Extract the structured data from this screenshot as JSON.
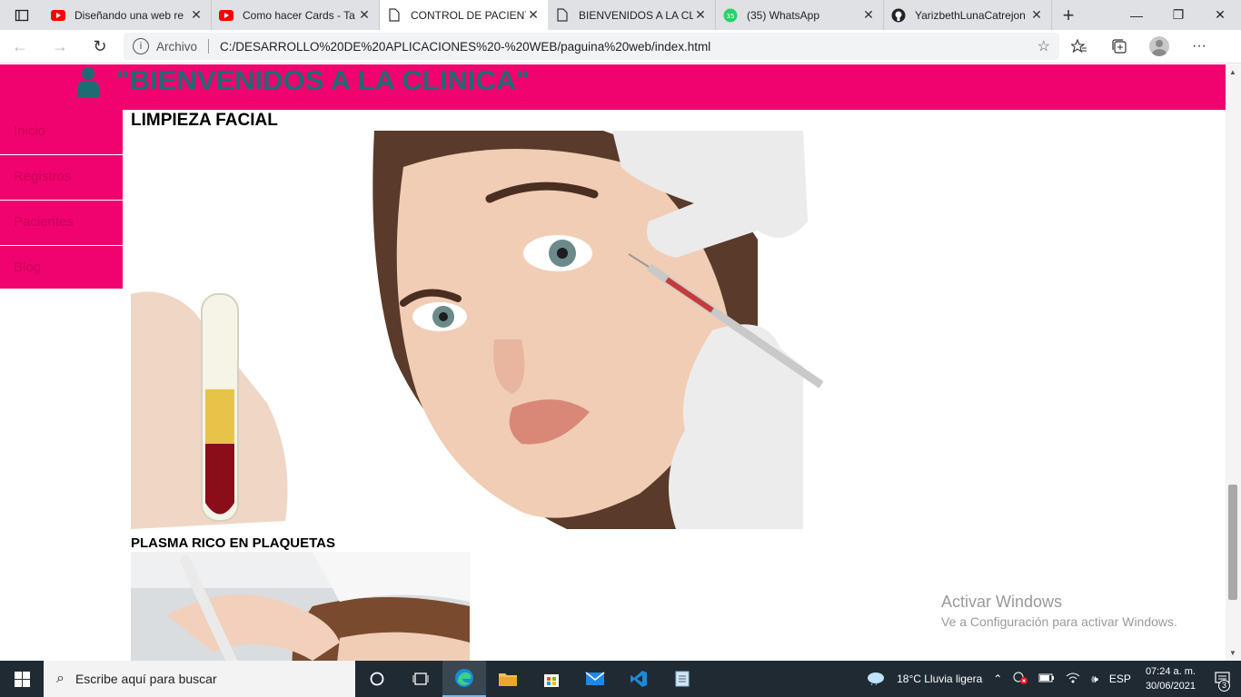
{
  "browser": {
    "tabs": [
      {
        "title": "Diseñando una web re",
        "icon": "youtube-icon",
        "active": false
      },
      {
        "title": "Como hacer Cards - Ta",
        "icon": "youtube-icon",
        "active": false
      },
      {
        "title": "CONTROL DE PACIENT",
        "icon": "page-icon",
        "active": true
      },
      {
        "title": "BIENVENIDOS A LA CL",
        "icon": "page-icon",
        "active": false
      },
      {
        "title": "(35) WhatsApp",
        "icon": "whatsapp-icon",
        "active": false
      },
      {
        "title": "YarizbethLunaCatrejon",
        "icon": "github-icon",
        "active": false
      }
    ],
    "address": {
      "scheme_label": "Archivo",
      "url": "C:/DESARROLLO%20DE%20APLICACIONES%20-%20WEB/paguina%20web/index.html"
    }
  },
  "site": {
    "title": "\"BIENVENIDOS A LA CLINICA\"",
    "nav": [
      {
        "label": "Inicio"
      },
      {
        "label": "Registros"
      },
      {
        "label": "Pacientes"
      },
      {
        "label": "Blog"
      }
    ],
    "sections": [
      {
        "title": "LIMPIEZA FACIAL"
      },
      {
        "title": "PLASMA RICO EN PLAQUETAS"
      }
    ],
    "colors": {
      "brand": "#f0036f",
      "title_text": "#1f6b73"
    }
  },
  "watermark": {
    "line1": "Activar Windows",
    "line2": "Ve a Configuración para activar Windows."
  },
  "taskbar": {
    "search_placeholder": "Escribe aquí para buscar",
    "weather": "18°C  Lluvia ligera",
    "language": "ESP",
    "time": "07:24 a. m.",
    "date": "30/06/2021",
    "notifications": "3"
  }
}
